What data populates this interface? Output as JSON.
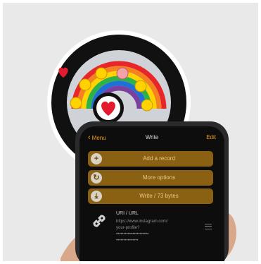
{
  "phone": {
    "nav": {
      "back_label": "Menu",
      "title": "Write",
      "edit_label": "Edit"
    },
    "buttons": [
      {
        "label": "Add a record",
        "icon": "plus-icon"
      },
      {
        "label": "More options",
        "icon": "refresh-icon"
      },
      {
        "label": "Write / 73 bytes",
        "icon": "download-icon"
      }
    ],
    "record": {
      "title": "URI / URL",
      "lines": [
        "https://www.instagram.com/",
        "your-profile?",
        "••••••••••••••••••••••",
        "•••••••••••••••"
      ]
    }
  },
  "sticker": {
    "colors": {
      "rainbow": [
        "#e8262a",
        "#f58220",
        "#ffd200",
        "#2fb14a",
        "#1e6fd8",
        "#7b3fa0"
      ],
      "ring": "#111111",
      "heart": "#e21b2e"
    }
  }
}
